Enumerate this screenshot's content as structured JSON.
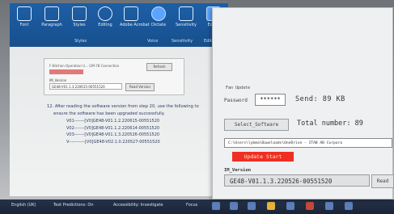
{
  "word": {
    "ribbon": {
      "buttons": [
        {
          "label": "Font",
          "icon": "font-icon"
        },
        {
          "label": "Paragraph",
          "icon": "paragraph-icon"
        },
        {
          "label": "Styles",
          "icon": "styles-icon"
        },
        {
          "label": "Editing",
          "icon": "editing-icon"
        },
        {
          "label": "Adobe Acrobat",
          "icon": "acrobat-icon"
        },
        {
          "label": "Dictate",
          "icon": "microphone-icon"
        },
        {
          "label": "Sensitivity",
          "icon": "sensitivity-icon"
        },
        {
          "label": "Editor",
          "icon": "editor-icon"
        }
      ],
      "groups": [
        "Styles",
        "Voice",
        "Sensitivity",
        "Editor"
      ]
    },
    "document": {
      "embedded_screenshot": {
        "heading": "F-Kitchen Operation U... GM-78 Connection",
        "button1": "Refresh",
        "version_label": "IM_Version",
        "version_value": "GE48-V01.1.3.220615-00551520",
        "button2": "Read Version"
      },
      "step_text": "12. After reading the software version from step 20, use the following to",
      "step_text2": "ensure the software has been upgraded successfully.",
      "versions": [
        "V01-------[V0]GE48-V01.1.2.220615-00551520",
        "V02-------[V0]GE48-V01.1.2.220614-00551520",
        "V03-------[V0]GE48-V01.1.3.220526-00551520",
        "V-----------[V0]GE48-V02.1.0.220527-00551520"
      ]
    }
  },
  "taskbar": {
    "items": [
      "English (UK)",
      "Text Predictions: On",
      "Accessibility: Investigate",
      "Focus"
    ]
  },
  "tool": {
    "group_title": "Fan Update",
    "password_label": "Password",
    "password_value": "******",
    "send": "Send:  89 KB",
    "select_button": "Select_Software",
    "total": "Total number:  89",
    "path": "C:\\Users\\lybma\\Downloads\\OneDrive - ITAB AB Corpora",
    "update_button": "Update Start",
    "version_label": "IM_Version",
    "version_value": "GE48-V01.1.3.220526-00551520",
    "read_button": "Read"
  },
  "colors": {
    "ribbon": "#1d5fa7",
    "update_button": "#ee2f22",
    "taskbar": "#1f2b40"
  }
}
